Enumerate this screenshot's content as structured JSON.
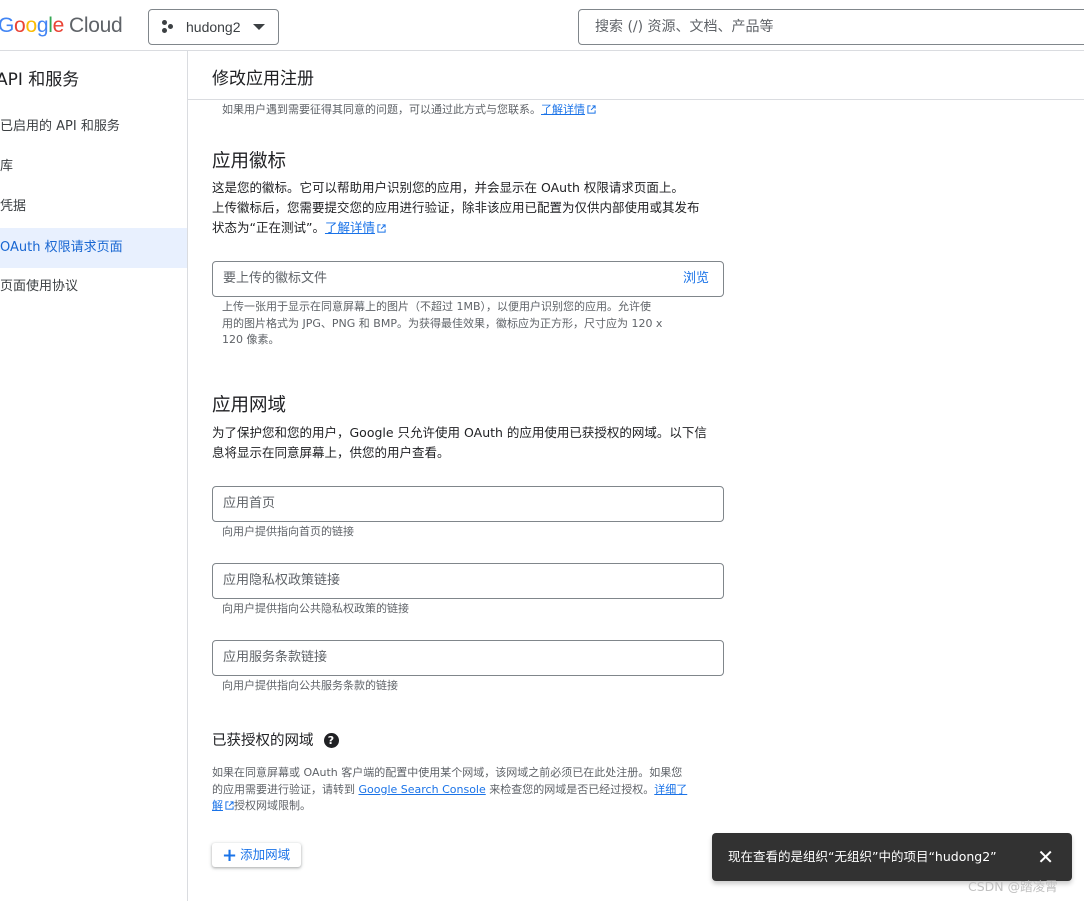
{
  "topbar": {
    "logo_parts": [
      "G",
      "o",
      "o",
      "g",
      "l",
      "e"
    ],
    "logo_cloud": "Cloud",
    "project_name": "hudong2",
    "search_placeholder": "搜索 (/) 资源、文档、产品等"
  },
  "sidebar": {
    "title": "API 和服务",
    "items": [
      {
        "label": "已启用的 API 和服务",
        "active": false
      },
      {
        "label": "库",
        "active": false
      },
      {
        "label": "凭据",
        "active": false
      },
      {
        "label": "OAuth 权限请求页面",
        "active": true
      },
      {
        "label": "页面使用协议",
        "active": false
      }
    ]
  },
  "main": {
    "title": "修改应用注册",
    "support_note": "如果用户遇到需要征得其同意的问题，可以通过此方式与您联系。",
    "support_link": "了解详情",
    "logo_section": {
      "title": "应用徽标",
      "desc_line1": "这是您的徽标。它可以帮助用户识别您的应用，并会显示在 OAuth 权限请求页面上。",
      "desc_line2": "上传徽标后，您需要提交您的应用进行验证，除非该应用已配置为仅供内部使用或其发布",
      "desc_line3": "状态为“正在测试”。",
      "desc_link": "了解详情",
      "file_placeholder": "要上传的徽标文件",
      "browse": "浏览",
      "hint_line1": "上传一张用于显示在同意屏幕上的图片（不超过 1MB），以便用户识别您的应用。允许使",
      "hint_line2": "用的图片格式为 JPG、PNG 和 BMP。为获得最佳效果，徽标应为正方形，尺寸应为 120 x",
      "hint_line3": "120 像素。"
    },
    "domain_section": {
      "title": "应用网域",
      "desc_line1": "为了保护您和您的用户，Google 只允许使用 OAuth 的应用使用已获授权的网域。以下信",
      "desc_line2": "息将显示在同意屏幕上，供您的用户查看。",
      "homepage_placeholder": "应用首页",
      "homepage_hint": "向用户提供指向首页的链接",
      "privacy_placeholder": "应用隐私权政策链接",
      "privacy_hint": "向用户提供指向公共隐私权政策的链接",
      "tos_placeholder": "应用服务条款链接",
      "tos_hint": "向用户提供指向公共服务条款的链接"
    },
    "authorized": {
      "title": "已获授权的网域",
      "help_icon": "?",
      "line1": "如果在同意屏幕或 OAuth 客户端的配置中使用某个网域，该网域之前必须已在此处注册。如果您",
      "line2_pre": "的应用需要进行验证，请转到 ",
      "line2_link": "Google Search Console",
      "line2_post": " 来检查您的网域是否已经过授权。",
      "line2_link2": "详细了",
      "line3_link": "解",
      "line3_post": "授权网域限制。",
      "add_button": "添加网域"
    }
  },
  "snackbar": {
    "message": "现在查看的是组织“无组织”中的项目“hudong2”",
    "close": "✕"
  },
  "watermark": "CSDN @踏凌霄",
  "colors": {
    "accent": "#1a73e8",
    "active_bg": "#e8f0fe",
    "snackbar_bg": "#323232"
  }
}
